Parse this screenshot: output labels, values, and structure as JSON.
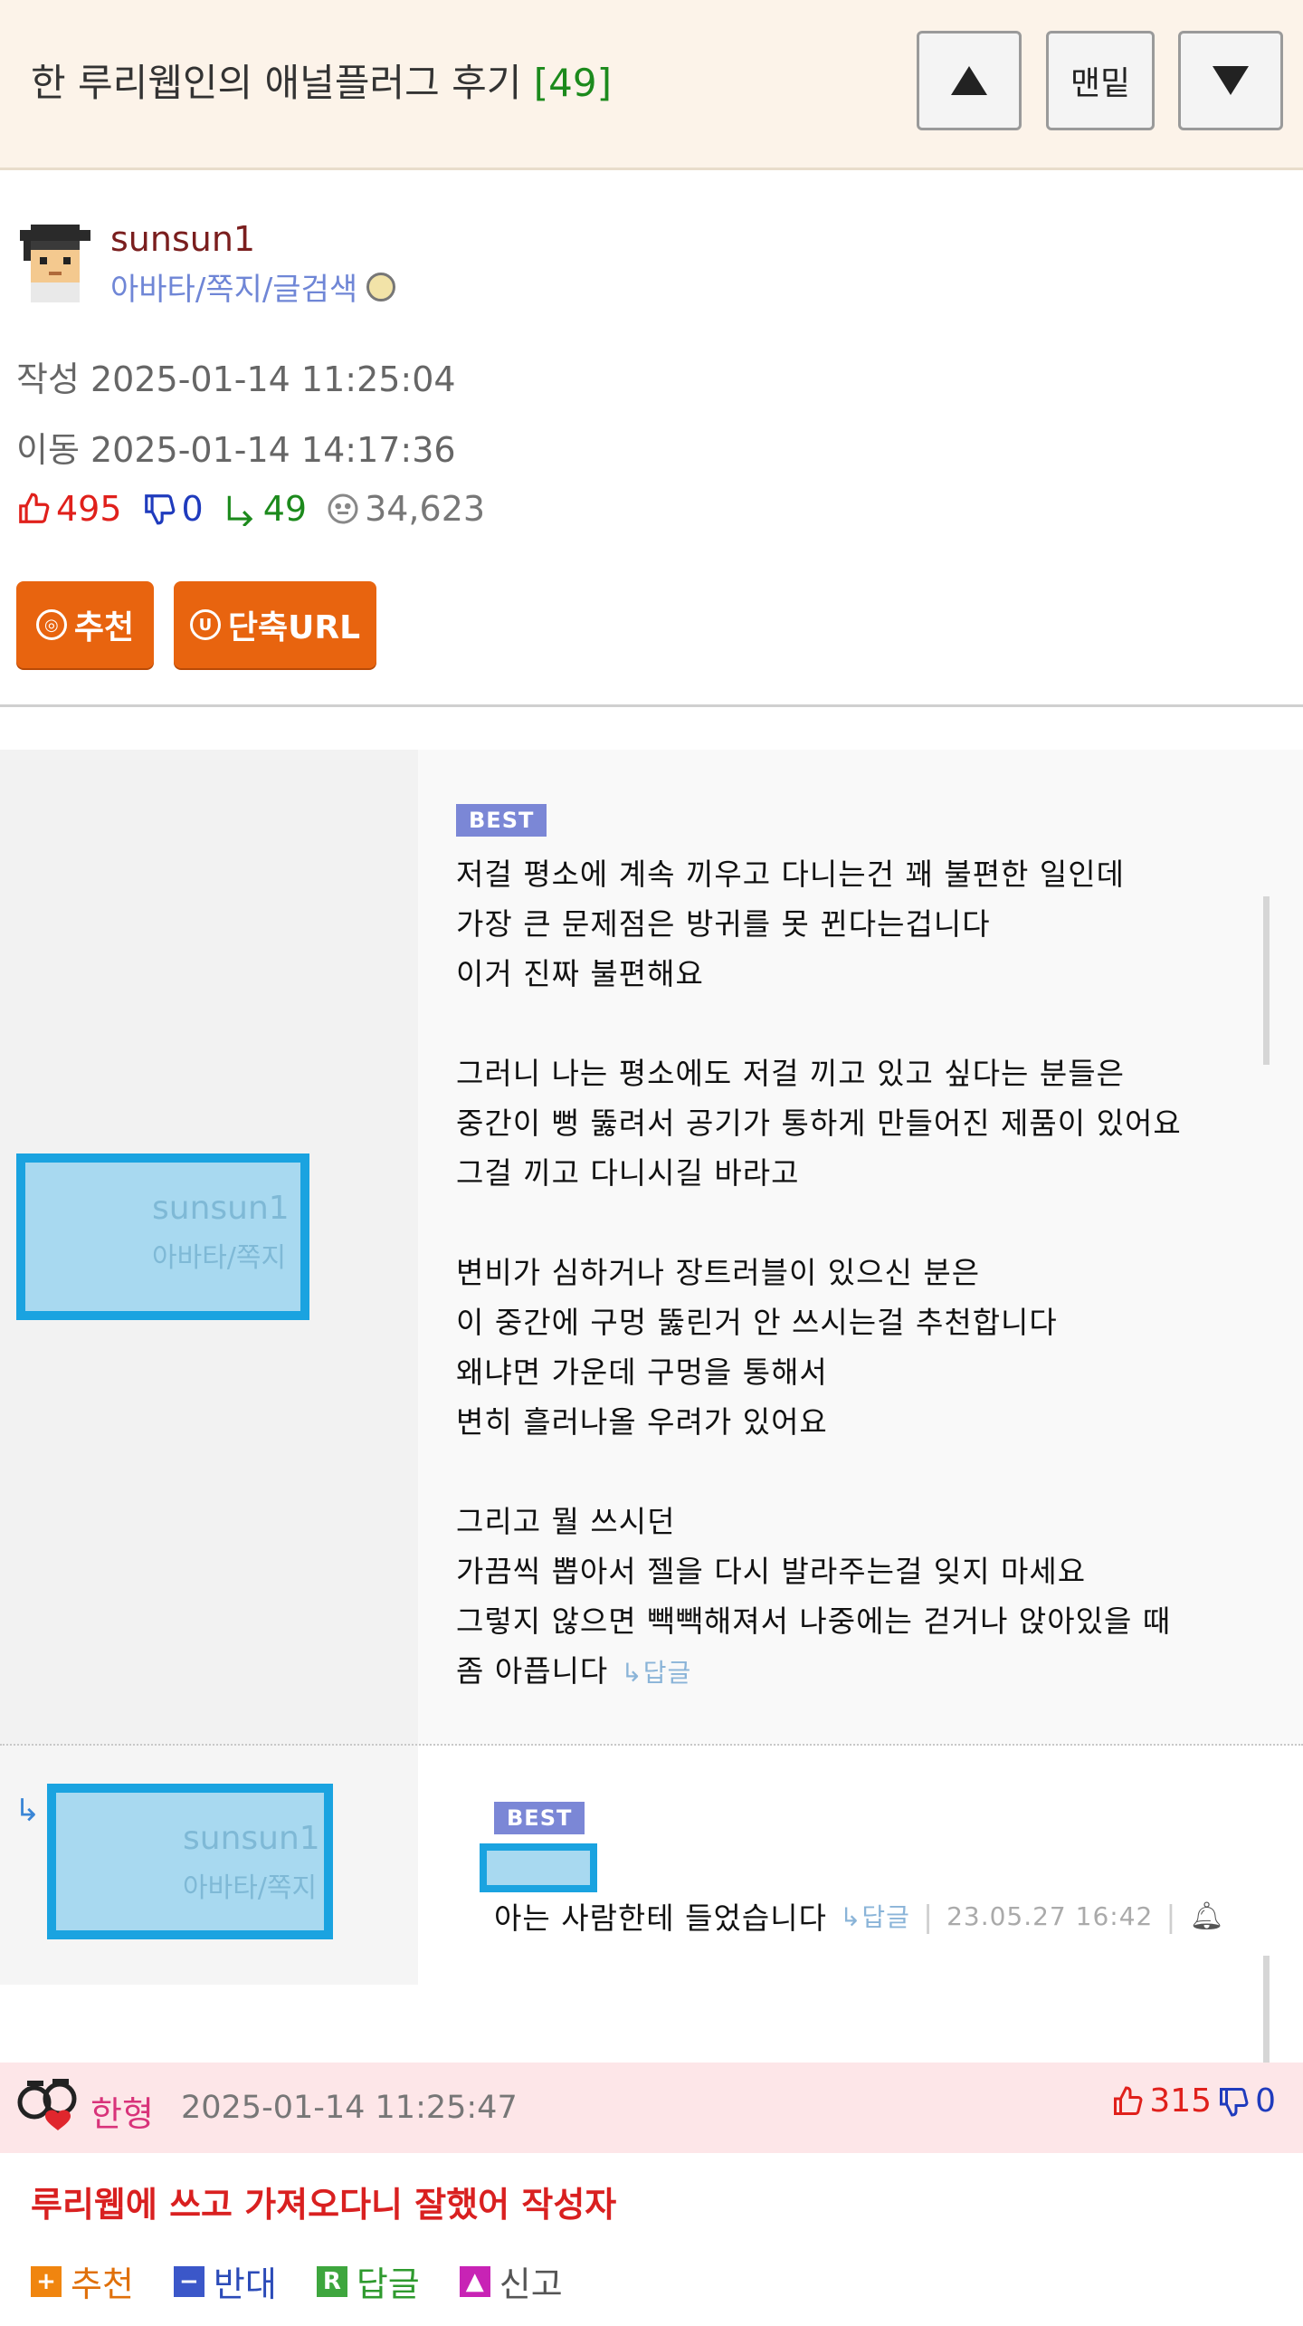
{
  "header": {
    "title": "한 루리웹인의 애널플러그 후기",
    "reply_count": "[49]",
    "nav_up_icon": "triangle-up-icon",
    "nav_bottom_label": "맨밑",
    "nav_down_icon": "triangle-down-icon"
  },
  "author": {
    "name": "sunsun1",
    "links": "아바타/쪽지/글검색",
    "written": "작성 2025-01-14 11:25:04",
    "moved": "이동 2025-01-14 14:17:36"
  },
  "stats": {
    "likes": "495",
    "dislikes": "0",
    "replies": "49",
    "views": "34,623"
  },
  "buttons": {
    "recommend": "추천",
    "short_url": "단축URL"
  },
  "best_comment": {
    "badge": "BEST",
    "blur_name": "sunsun1",
    "blur_links": "아바타/쪽지",
    "lines_1": [
      "저걸 평소에 계속 끼우고 다니는건 꽤 불편한 일인데",
      "가장 큰 문제점은 방귀를 못 뀐다는겁니다",
      "이거 진짜 불편해요"
    ],
    "lines_2": [
      "그러니 나는 평소에도 저걸 끼고 있고 싶다는 분들은",
      "중간이 뻥 뚫려서 공기가 통하게 만들어진 제품이 있어요",
      "그걸 끼고 다니시길 바라고"
    ],
    "lines_3": [
      "변비가 심하거나 장트러블이 있으신 분은",
      "이 중간에 구멍 뚫린거 안 쓰시는걸 추천합니다",
      "왜냐면 가운데 구멍을 통해서",
      "변히 흘러나올 우려가 있어요"
    ],
    "lines_4": [
      "그리고 뭘 쓰시던",
      "가끔씩 뽑아서 젤을 다시 발라주는걸 잊지 마세요",
      "그렇지 않으면 빽빽해져서 나중에는 걷거나 앉아있을 때"
    ],
    "last_line": "좀 아픕니다",
    "reply_link": "↳답글"
  },
  "best_reply": {
    "badge": "BEST",
    "blur_name": "sunsun1",
    "blur_links": "아바타/쪽지",
    "text": "아는 사람한테 들었습니다",
    "reply_link": "↳답글",
    "date": "23.05.27 16:42",
    "bell_icon": "bell-icon"
  },
  "comment": {
    "author": "한형",
    "date": "2025-01-14 11:25:47",
    "likes": "315",
    "dislikes": "0",
    "title": "루리웹에 쓰고 가져오다니 잘했어 작성자",
    "actions": {
      "recommend": "추천",
      "oppose": "반대",
      "reply": "답글",
      "report": "신고"
    }
  },
  "colors": {
    "header_bg": "#fcf3e9",
    "orange_button": "#e8640f",
    "like_red": "#e0201b",
    "dislike_blue": "#1f3bbd",
    "reply_green": "#1c8a1c",
    "comment_bar_bg": "#fde6e8",
    "best_badge": "#7b87d6"
  }
}
